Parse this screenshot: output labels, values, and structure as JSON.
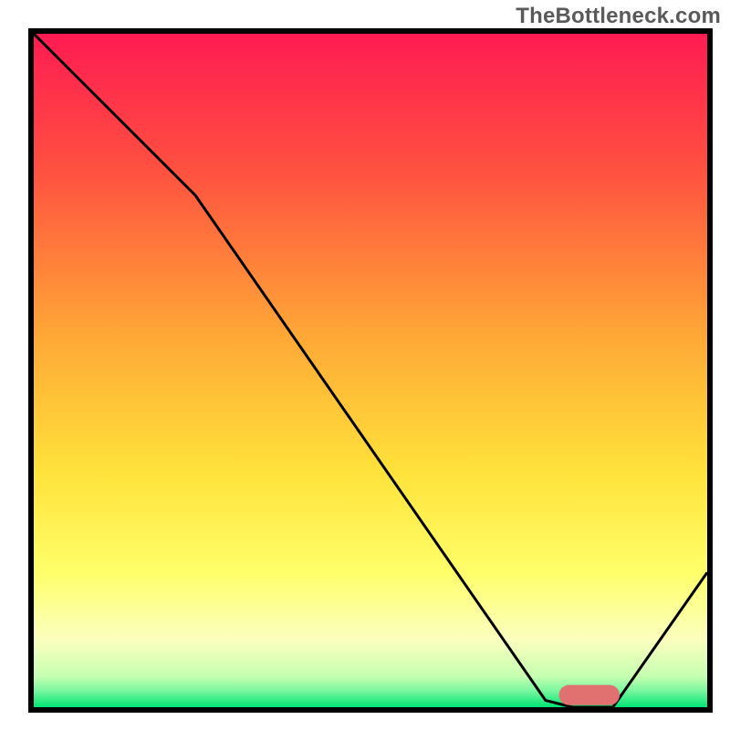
{
  "watermark": "TheBottleneck.com",
  "colors": {
    "border": "#000000",
    "curve": "#000000",
    "marker_fill": "#e17070",
    "gradient_stops": [
      {
        "offset": 0.0,
        "color": "#ff1b52"
      },
      {
        "offset": 0.2,
        "color": "#ff5040"
      },
      {
        "offset": 0.45,
        "color": "#ffa836"
      },
      {
        "offset": 0.65,
        "color": "#ffe23a"
      },
      {
        "offset": 0.8,
        "color": "#ffff6a"
      },
      {
        "offset": 0.9,
        "color": "#fbffbe"
      },
      {
        "offset": 0.955,
        "color": "#c4ffb0"
      },
      {
        "offset": 0.975,
        "color": "#7cf7a0"
      },
      {
        "offset": 1.0,
        "color": "#00e573"
      }
    ]
  },
  "chart_data": {
    "type": "line",
    "title": "",
    "xlabel": "",
    "ylabel": "",
    "xlim": [
      0,
      100
    ],
    "ylim": [
      0,
      100
    ],
    "grid": false,
    "series": [
      {
        "name": "bottleneck-curve",
        "x": [
          0,
          8,
          24,
          76,
          80,
          86,
          100
        ],
        "y": [
          100,
          92,
          76,
          1,
          0,
          0,
          20
        ]
      }
    ],
    "marker": {
      "name": "optimal-range",
      "shape": "rounded-bar",
      "x_start": 78,
      "x_end": 87,
      "y": 1.8,
      "height": 3.0
    }
  }
}
